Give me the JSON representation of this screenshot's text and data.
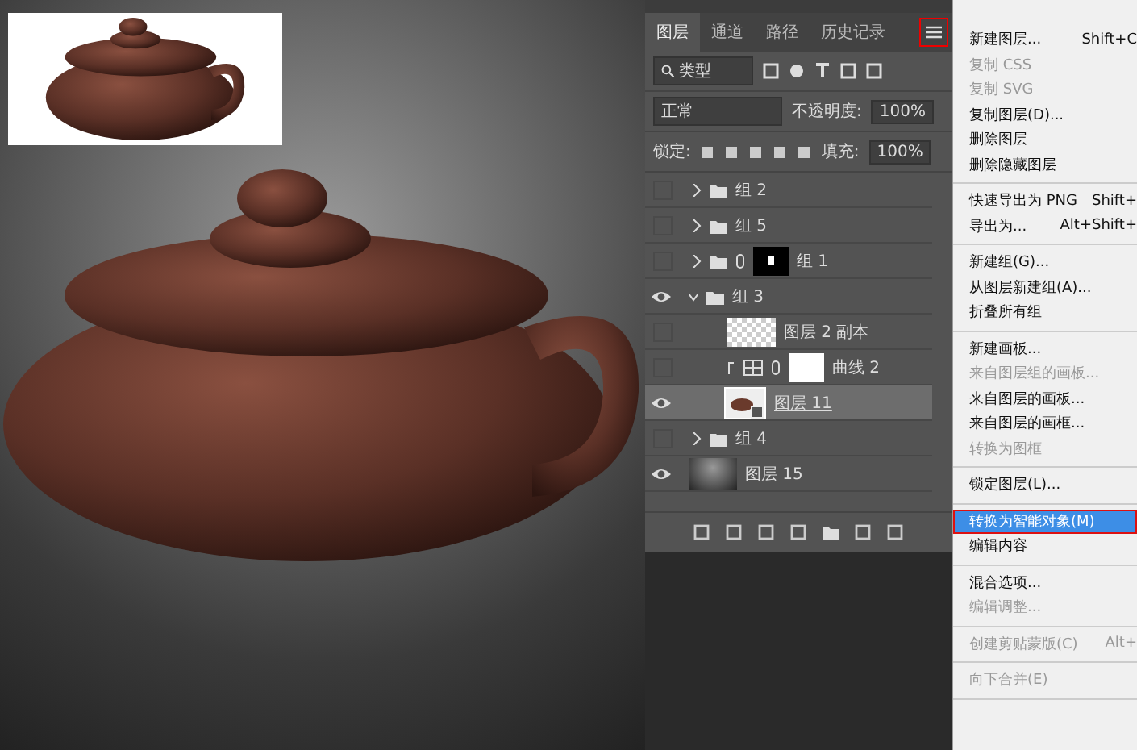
{
  "layers_panel": {
    "tabs": [
      {
        "label": "图层",
        "selected": true
      },
      {
        "label": "通道",
        "selected": false
      },
      {
        "label": "路径",
        "selected": false
      },
      {
        "label": "历史记录",
        "selected": false
      }
    ],
    "filter": {
      "value": "类型"
    },
    "blend_mode": {
      "value": "正常"
    },
    "opacity": {
      "label": "不透明度:",
      "value": "100%"
    },
    "lock": {
      "label": "锁定:"
    },
    "fill": {
      "label": "填充:",
      "value": "100%"
    },
    "layers": [
      {
        "name": "组 2",
        "kind": "group",
        "visible": false,
        "expanded": false,
        "selected": false
      },
      {
        "name": "组 5",
        "kind": "group",
        "visible": false,
        "expanded": false,
        "selected": false
      },
      {
        "name": "组 1",
        "kind": "group-mask",
        "visible": false,
        "expanded": false,
        "selected": false
      },
      {
        "name": "组 3",
        "kind": "group",
        "visible": true,
        "expanded": true,
        "selected": false,
        "children": [
          {
            "name": "图层 2 副本",
            "kind": "transparent",
            "visible": false,
            "selected": false
          },
          {
            "name": "曲线 2",
            "kind": "curves",
            "visible": false,
            "selected": false
          },
          {
            "name": "图层 11",
            "kind": "smart",
            "visible": true,
            "selected": true
          }
        ]
      },
      {
        "name": "组 4",
        "kind": "group",
        "visible": false,
        "expanded": false,
        "selected": false
      },
      {
        "name": "图层 15",
        "kind": "gradient",
        "visible": true,
        "selected": false
      }
    ]
  },
  "menu": {
    "sections": [
      [
        {
          "label": "新建图层...",
          "shortcut": "Shift+C",
          "disabled": false,
          "selected": false
        },
        {
          "label": "复制 CSS",
          "disabled": true,
          "selected": false
        },
        {
          "label": "复制 SVG",
          "disabled": true,
          "selected": false
        },
        {
          "label": "复制图层(D)...",
          "disabled": false,
          "selected": false
        },
        {
          "label": "删除图层",
          "disabled": false,
          "selected": false
        },
        {
          "label": "删除隐藏图层",
          "disabled": false,
          "selected": false
        }
      ],
      [
        {
          "label": "快速导出为 PNG",
          "shortcut": "Shift+",
          "disabled": false,
          "selected": false
        },
        {
          "label": "导出为...",
          "shortcut": "Alt+Shift+",
          "disabled": false,
          "selected": false
        }
      ],
      [
        {
          "label": "新建组(G)...",
          "disabled": false,
          "selected": false
        },
        {
          "label": "从图层新建组(A)...",
          "disabled": false,
          "selected": false
        },
        {
          "label": "折叠所有组",
          "disabled": false,
          "selected": false
        }
      ],
      [
        {
          "label": "新建画板...",
          "disabled": false,
          "selected": false
        },
        {
          "label": "来自图层组的画板...",
          "disabled": true,
          "selected": false
        },
        {
          "label": "来自图层的画板...",
          "disabled": false,
          "selected": false
        },
        {
          "label": "来自图层的画框...",
          "disabled": false,
          "selected": false
        },
        {
          "label": "转换为图框",
          "disabled": true,
          "selected": false
        }
      ],
      [
        {
          "label": "锁定图层(L)...",
          "disabled": false,
          "selected": false
        }
      ],
      [
        {
          "label": "转换为智能对象(M)",
          "disabled": false,
          "selected": true
        },
        {
          "label": "编辑内容",
          "disabled": false,
          "selected": false
        }
      ],
      [
        {
          "label": "混合选项...",
          "disabled": false,
          "selected": false
        },
        {
          "label": "编辑调整...",
          "disabled": true,
          "selected": false
        }
      ],
      [
        {
          "label": "创建剪贴蒙版(C)",
          "shortcut": "Alt+",
          "disabled": true,
          "selected": false
        }
      ],
      [
        {
          "label": "向下合并(E)",
          "disabled": true,
          "selected": false
        }
      ]
    ]
  }
}
